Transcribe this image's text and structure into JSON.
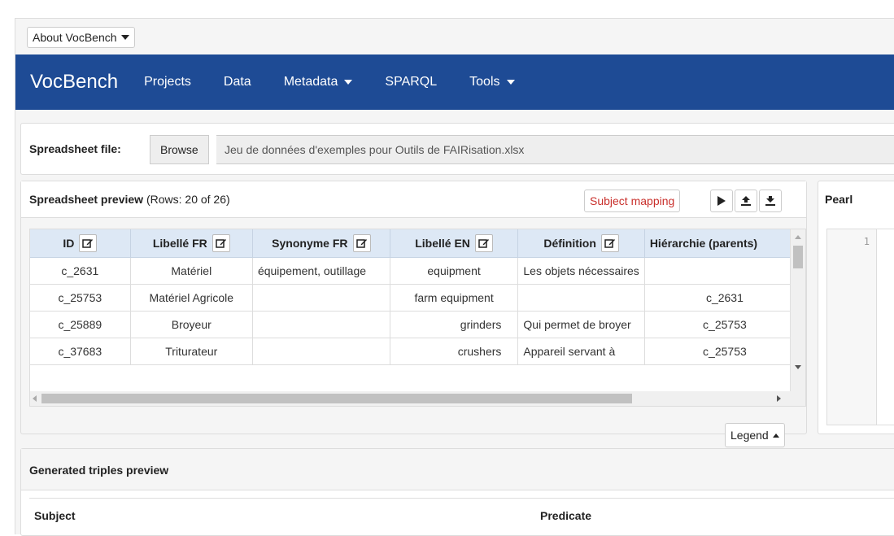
{
  "about": {
    "label": "About VocBench"
  },
  "navbar": {
    "brand": "VocBench",
    "items": [
      {
        "label": "Projects",
        "dropdown": false
      },
      {
        "label": "Data",
        "dropdown": false
      },
      {
        "label": "Metadata",
        "dropdown": true
      },
      {
        "label": "SPARQL",
        "dropdown": false
      },
      {
        "label": "Tools",
        "dropdown": true
      }
    ],
    "color": "#1e4b95"
  },
  "file": {
    "label": "Spreadsheet file:",
    "browse": "Browse",
    "name": "Jeu de données d'exemples pour Outils de FAIRisation.xlsx"
  },
  "preview": {
    "title": "Spreadsheet preview",
    "rows_info": "(Rows: 20 of 26)",
    "subject_mapping": "Subject mapping",
    "columns": [
      "ID",
      "Libellé FR",
      "Synonyme FR",
      "Libellé EN",
      "Définition",
      "Hiérarchie (parents)"
    ],
    "rows": [
      [
        "c_2631",
        "Matériel",
        "équipement, outillage",
        "equipment",
        "Les objets nécessaires",
        ""
      ],
      [
        "c_25753",
        "Matériel Agricole",
        "",
        "farm equipment",
        "",
        "c_2631"
      ],
      [
        "c_25889",
        "Broyeur",
        "",
        "grinders",
        "Qui permet de broyer",
        "c_25753"
      ],
      [
        "c_37683",
        "Triturateur",
        "",
        "crushers",
        "Appareil servant à",
        "c_25753"
      ]
    ],
    "legend": "Legend"
  },
  "pearl": {
    "title": "Pearl",
    "line": "1"
  },
  "triples": {
    "title": "Generated triples preview",
    "columns": [
      "Subject",
      "Predicate"
    ]
  }
}
